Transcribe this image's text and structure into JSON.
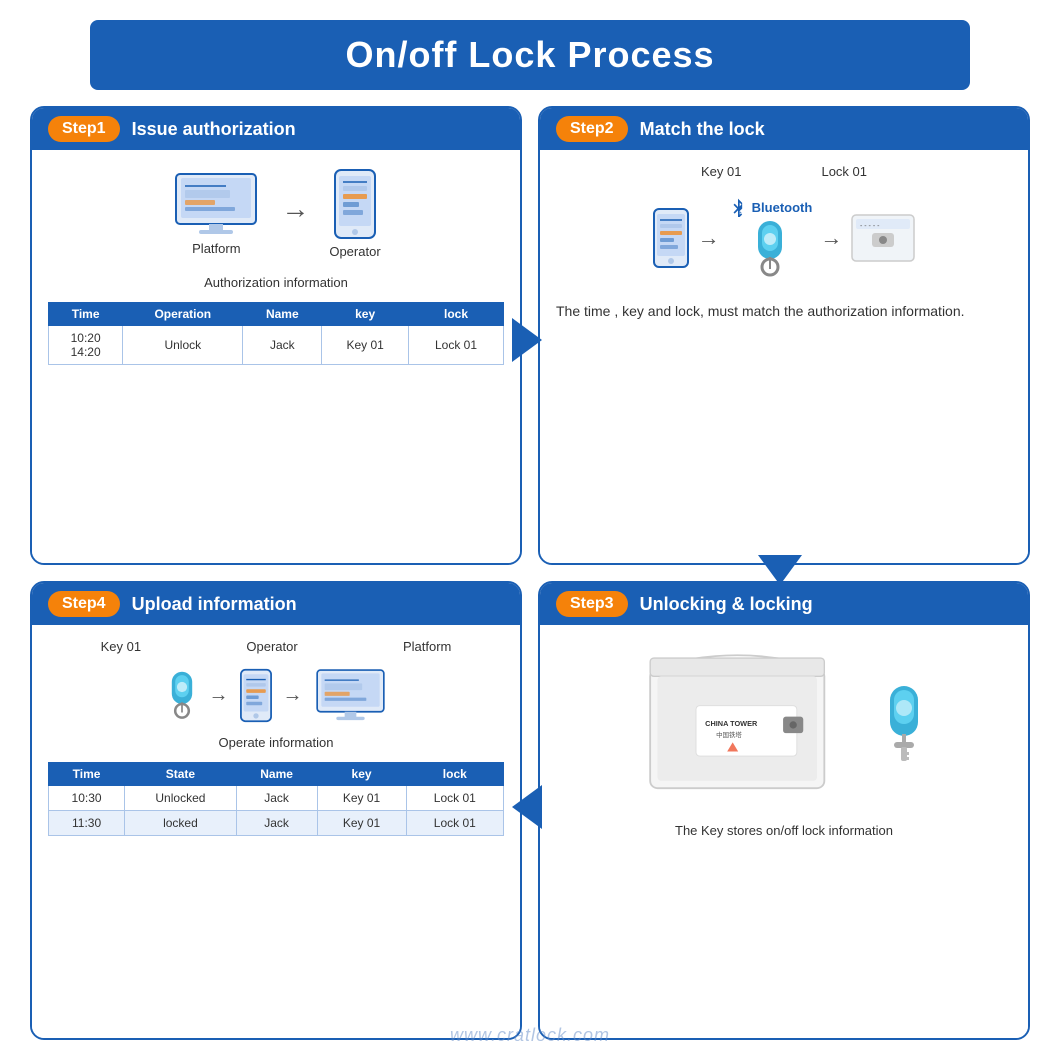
{
  "title": "On/off Lock Process",
  "step1": {
    "badge": "Step1",
    "header": "Issue authorization",
    "platform_label": "Platform",
    "operator_label": "Operator",
    "auth_label": "Authorization information",
    "table_headers": [
      "Time",
      "Operation",
      "Name",
      "key",
      "lock"
    ],
    "table_rows": [
      {
        "time": "10:20\n14:20",
        "operation": "Unlock",
        "name": "Jack",
        "key": "Key 01",
        "lock": "Lock 01"
      }
    ]
  },
  "step2": {
    "badge": "Step2",
    "header": "Match the lock",
    "key_label": "Key 01",
    "lock_label": "Lock 01",
    "bluetooth_text": "Bluetooth",
    "description": "The time , key and lock,  must match the authorization information."
  },
  "step3": {
    "badge": "Step3",
    "header": "Unlocking &  locking",
    "caption": "The Key stores on/off lock information"
  },
  "step4": {
    "badge": "Step4",
    "header": "Upload information",
    "key_label": "Key 01",
    "operator_label": "Operator",
    "platform_label": "Platform",
    "operate_label": "Operate information",
    "table_headers": [
      "Time",
      "State",
      "Name",
      "key",
      "lock"
    ],
    "table_rows": [
      {
        "time": "10:30",
        "state": "Unlocked",
        "name": "Jack",
        "key": "Key 01",
        "lock": "Lock 01"
      },
      {
        "time": "11:30",
        "state": "locked",
        "name": "Jack",
        "key": "Key 01",
        "lock": "Lock 01"
      }
    ]
  },
  "watermark": "www.cratlock.com"
}
